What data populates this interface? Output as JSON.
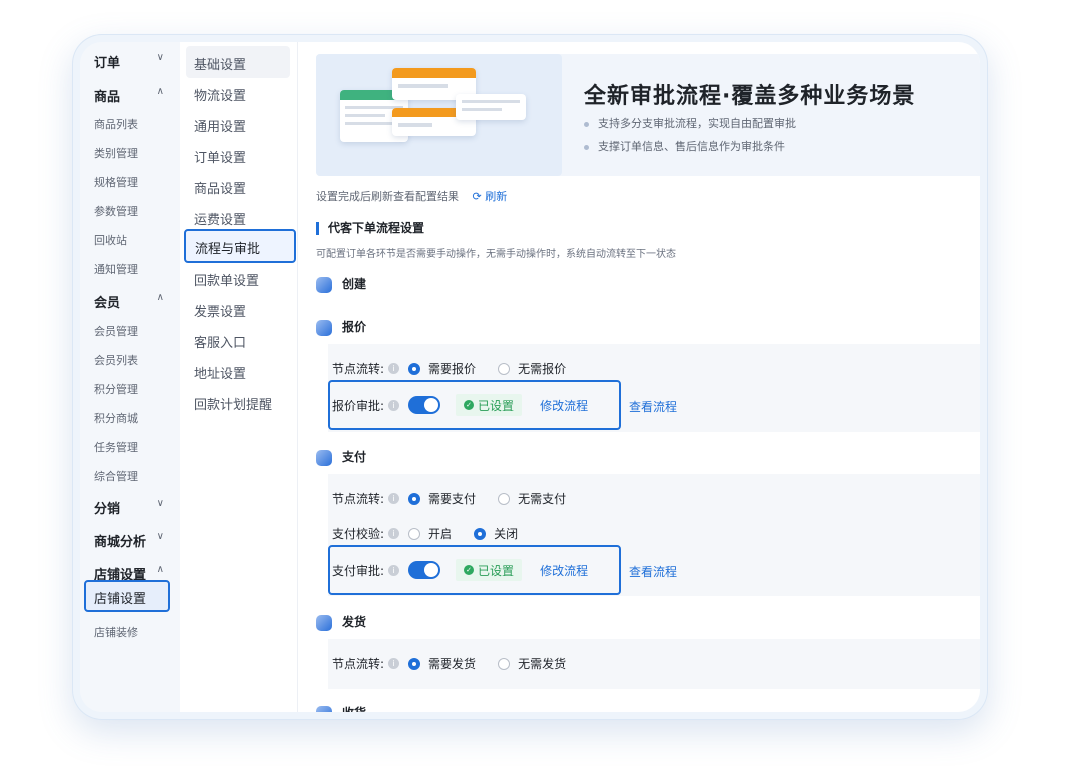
{
  "nav1": {
    "groups": [
      {
        "label": "订单",
        "chev": "∨"
      },
      {
        "label": "商品",
        "chev": "∧"
      },
      {
        "label": "会员",
        "chev": "∧"
      },
      {
        "label": "分销",
        "chev": "∨"
      },
      {
        "label": "商城分析",
        "chev": "∨"
      },
      {
        "label": "店铺设置",
        "chev": "∧"
      }
    ],
    "goods_items": [
      "商品列表",
      "类别管理",
      "规格管理",
      "参数管理",
      "回收站",
      "通知管理"
    ],
    "member_items": [
      "会员管理",
      "会员列表",
      "积分管理",
      "积分商城",
      "任务管理",
      "综合管理"
    ],
    "store_items": [
      "店铺设置",
      "店铺装修"
    ]
  },
  "nav2": {
    "items": [
      "基础设置",
      "物流设置",
      "通用设置",
      "订单设置",
      "商品设置",
      "运费设置",
      "流程与审批",
      "回款单设置",
      "发票设置",
      "客服入口",
      "地址设置",
      "回款计划提醒"
    ]
  },
  "banner": {
    "title": "全新审批流程·覆盖多种业务场景",
    "bullets": [
      "支持多分支审批流程，实现自由配置审批",
      "支撑订单信息、售后信息作为审批条件"
    ]
  },
  "refresh": {
    "text": "设置完成后刷新查看配置结果",
    "link": "刷新",
    "icon": "refresh-icon"
  },
  "section": {
    "title": "代客下单流程设置",
    "desc": "可配置订单各环节是否需要手动操作，无需手动操作时，系统自动流转至下一状态"
  },
  "steps": {
    "create": "创建",
    "quote": {
      "label": "报价",
      "flow_label": "节点流转:",
      "opt_on": "需要报价",
      "opt_off": "无需报价",
      "approve_label": "报价审批:",
      "status": "已设置",
      "edit": "修改流程",
      "view": "查看流程"
    },
    "pay": {
      "label": "支付",
      "flow_label": "节点流转:",
      "opt_on": "需要支付",
      "opt_off": "无需支付",
      "check_label": "支付校验:",
      "check_on": "开启",
      "check_off": "关闭",
      "approve_label": "支付审批:",
      "status": "已设置",
      "edit": "修改流程",
      "view": "查看流程"
    },
    "ship": {
      "label": "发货",
      "flow_label": "节点流转:",
      "opt_on": "需要发货",
      "opt_off": "无需发货"
    },
    "receive": "收货"
  },
  "colors": {
    "accent": "#1f6fd8",
    "success": "#2a9d58",
    "banner_card": "#f39a1e"
  }
}
